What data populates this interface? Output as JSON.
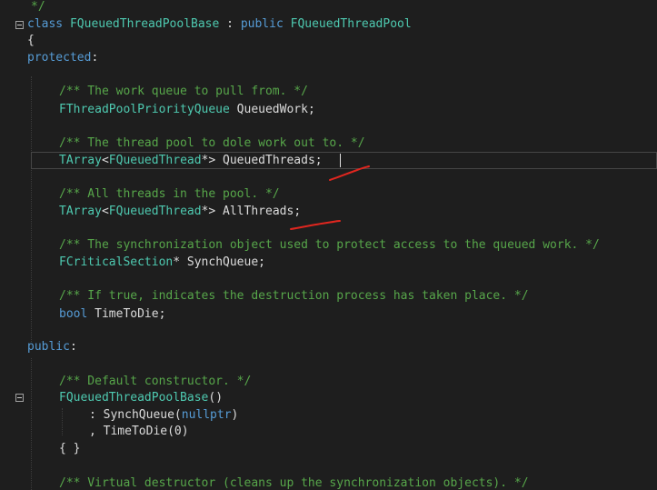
{
  "colors": {
    "background": "#1e1e1e",
    "keyword": "#569cd6",
    "type": "#4ec9b0",
    "comment": "#57a64a",
    "text": "#dcdcdc",
    "annotation": "#e0261f"
  },
  "code": {
    "l00": "*/",
    "l01_kw": "class",
    "l01_cls": "FQueuedThreadPoolBase",
    "l01_sep": " : ",
    "l01_kw2": "public",
    "l01_base": "FQueuedThreadPool",
    "l02": "{",
    "l03_kw": "protected",
    "l03_colon": ":",
    "l05_comment": "/** The work queue to pull from. */",
    "l06_type": "FThreadPoolPriorityQueue",
    "l06_name": "QueuedWork;",
    "l08_comment": "/** The thread pool to dole work out to. */",
    "l09_type": "TArray",
    "l09_lt": "<",
    "l09_arg": "FQueuedThread",
    "l09_ptr": "*>",
    "l09_name": "QueuedThreads",
    "l09_semi": ";",
    "l11_comment": "/** All threads in the pool. */",
    "l12_type": "TArray",
    "l12_lt": "<",
    "l12_arg": "FQueuedThread",
    "l12_ptr": "*>",
    "l12_name": "AllThreads",
    "l12_semi": ";",
    "l14_comment": "/** The synchronization object used to protect access to the queued work. */",
    "l15_type": "FCriticalSection",
    "l15_ptr": "*",
    "l15_name": "SynchQueue;",
    "l17_comment": "/** If true, indicates the destruction process has taken place. */",
    "l18_kw": "bool",
    "l18_name": "TimeToDie;",
    "l20_kw": "public",
    "l20_colon": ":",
    "l22_comment": "/** Default constructor. */",
    "l23_fn": "FQueuedThreadPoolBase",
    "l23_paren": "()",
    "l24_pre": ": SynchQueue(",
    "l24_kw": "nullptr",
    "l24_post": ")",
    "l25": ", TimeToDie(0)",
    "l26": "{ }",
    "l28_comment": "/** Virtual destructor (cleans up the synchronization objects). */"
  }
}
